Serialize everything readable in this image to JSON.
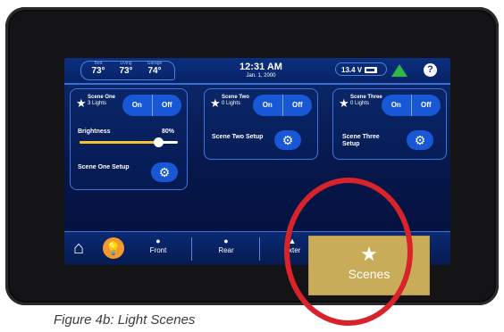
{
  "topbar": {
    "temps": [
      {
        "label": "Bed",
        "value": "73°"
      },
      {
        "label": "Living",
        "value": "73°"
      },
      {
        "label": "Garage",
        "value": "74°"
      }
    ],
    "time": "12:31 AM",
    "date": "Jan. 1, 2000",
    "voltage": "13.4 V",
    "help": "?"
  },
  "scenes": [
    {
      "name": "Scene One",
      "count": "3 Lights",
      "on": "On",
      "off": "Off",
      "setup": "Scene One Setup",
      "brightness_label": "Brightness",
      "brightness_pct": "80%",
      "brightness_value": 0.8
    },
    {
      "name": "Scene Two",
      "count": "0 Lights",
      "on": "On",
      "off": "Off",
      "setup": "Scene Two Setup"
    },
    {
      "name": "Scene Three",
      "count": "0 Lights",
      "on": "On",
      "off": "Off",
      "setup": "Scene Three Setup"
    }
  ],
  "nav": {
    "items": [
      "Front",
      "Rear",
      "Exter"
    ],
    "scenes_label": "Scenes"
  },
  "caption": "Figure 4b: Light Scenes",
  "colors": {
    "accent": "#1857d6",
    "scenes_tab": "#c9ac5a",
    "highlight_circle": "#d8232a"
  }
}
